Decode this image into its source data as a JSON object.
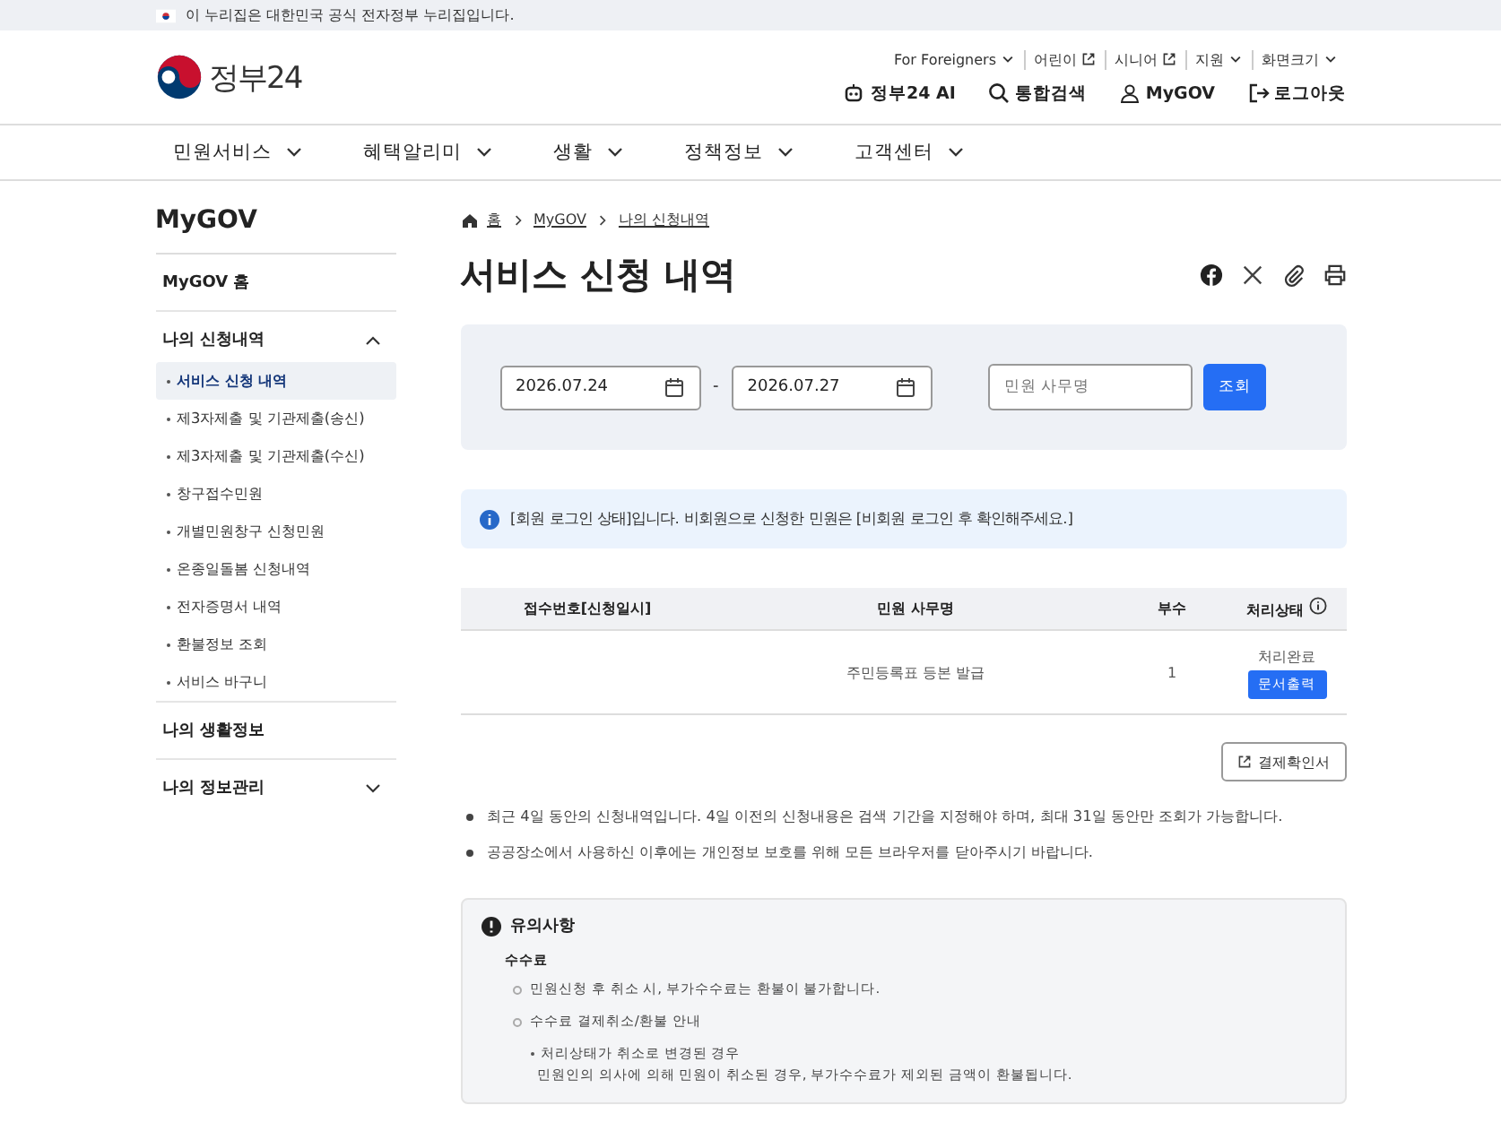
{
  "top_notice": "이 누리집은 대한민국 공식 전자정부 누리집입니다.",
  "header": {
    "logo_text": "정부24",
    "utility_links": [
      {
        "label": "For Foreigners",
        "kind": "dropdown"
      },
      {
        "label": "어린이",
        "kind": "external"
      },
      {
        "label": "시니어",
        "kind": "external"
      },
      {
        "label": "지원",
        "kind": "dropdown"
      },
      {
        "label": "화면크기",
        "kind": "dropdown"
      }
    ],
    "main_links": [
      {
        "label": "정부24 AI",
        "kind": "ai"
      },
      {
        "label": "통합검색",
        "kind": "search"
      },
      {
        "label": "MyGOV",
        "kind": "user"
      },
      {
        "label": "로그아웃",
        "kind": "logout"
      }
    ]
  },
  "nav": [
    "민원서비스",
    "혜택알리미",
    "생활",
    "정책정보",
    "고객센터"
  ],
  "sidebar": {
    "title": "MyGOV",
    "sections": [
      {
        "label": "MyGOV 홈"
      },
      {
        "label": "나의 신청내역",
        "expanded": true,
        "items": [
          {
            "label": "서비스 신청 내역",
            "selected": true
          },
          {
            "label": "제3자제출 및 기관제출(송신)",
            "selected": false
          },
          {
            "label": "제3자제출 및 기관제출(수신)",
            "selected": false
          },
          {
            "label": "창구접수민원",
            "selected": false
          },
          {
            "label": "개별민원창구 신청민원",
            "selected": false
          },
          {
            "label": "온종일돌봄 신청내역",
            "selected": false
          },
          {
            "label": "전자증명서 내역",
            "selected": false
          },
          {
            "label": "환불정보 조회",
            "selected": false
          },
          {
            "label": "서비스 바구니",
            "selected": false
          }
        ]
      },
      {
        "label": "나의 생활정보"
      },
      {
        "label": "나의 정보관리",
        "expanded": false
      }
    ]
  },
  "breadcrumb": [
    "홈",
    "MyGOV",
    "나의 신청내역"
  ],
  "page_title": "서비스 신청 내역",
  "search": {
    "date_from": "2026.07.24",
    "separator": "-",
    "date_to": "2026.07.27",
    "placeholder": "민원 사무명",
    "button": "조회"
  },
  "info_notice": "[회원 로그인 상태]입니다. 비회원으로 신청한 민원은 [비회원 로그인 후 확인해주세요.]",
  "table": {
    "columns": [
      "접수번호[신청일시]",
      "민원 사무명",
      "부수",
      "처리상태"
    ],
    "rows": [
      {
        "name": "주민등록표 등본 발급",
        "copies": "1",
        "status": "처리완료",
        "action": "문서출력"
      }
    ]
  },
  "receipt_button": "결제확인서",
  "notes": [
    "최근 4일 동안의 신청내역입니다. 4일 이전의 신청내용은 검색 기간을 지정해야 하며, 최대 31일 동안만 조회가 가능합니다.",
    "공공장소에서 사용하신 이후에는 개인정보 보호를 위해 모든 브라우저를 닫아주시기 바랍니다."
  ],
  "caution": {
    "title": "유의사항",
    "subtitle": "수수료",
    "items": [
      "민원신청 후 취소 시, 부가수수료는 환불이 불가합니다.",
      "수수료 결제취소/환불 안내"
    ],
    "details": [
      {
        "heading": "처리상태가 취소로 변경된 경우",
        "text": "민원인의 의사에 의해 민원이 취소된 경우, 부가수수료가 제외된 금액이 환불됩니다."
      }
    ]
  }
}
